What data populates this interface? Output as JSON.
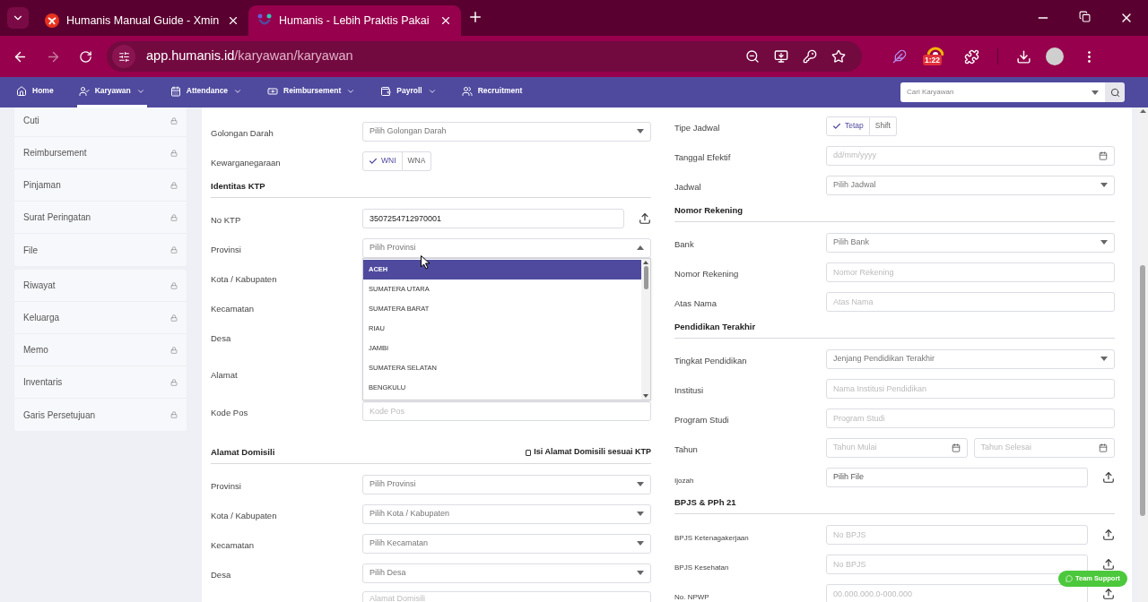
{
  "browser": {
    "tabs": [
      {
        "title": "Humanis Manual Guide - Xmin",
        "selected": false
      },
      {
        "title": "Humanis - Lebih Praktis Pakai",
        "selected": true
      }
    ],
    "url_host": "app.humanis.id",
    "url_path": "/karyawan/karyawan",
    "extension_badge": "1:22"
  },
  "nav": {
    "items": [
      {
        "label": "Home",
        "selected": false,
        "has_menu": false
      },
      {
        "label": "Karyawan",
        "selected": true,
        "has_menu": true
      },
      {
        "label": "Attendance",
        "selected": false,
        "has_menu": true
      },
      {
        "label": "Reimbursement",
        "selected": false,
        "has_menu": true
      },
      {
        "label": "Payroll",
        "selected": false,
        "has_menu": true
      },
      {
        "label": "Recruitment",
        "selected": false,
        "has_menu": false
      }
    ],
    "search_placeholder": "Cari Karyawan"
  },
  "sidebar": {
    "groups": [
      {
        "items": [
          {
            "label": "Cuti",
            "locked": true
          },
          {
            "label": "Reimbursement",
            "locked": true
          },
          {
            "label": "Pinjaman",
            "locked": true
          },
          {
            "label": "Surat Peringatan",
            "locked": true
          },
          {
            "label": "File",
            "locked": true
          }
        ]
      },
      {
        "items": [
          {
            "label": "Riwayat",
            "locked": true
          },
          {
            "label": "Keluarga",
            "locked": true
          },
          {
            "label": "Memo",
            "locked": true
          },
          {
            "label": "Inventaris",
            "locked": true
          },
          {
            "label": "Garis Persetujuan",
            "locked": true
          }
        ]
      }
    ]
  },
  "form": {
    "left": [
      {
        "kind": "select",
        "label": "Golongan Darah",
        "placeholder": "Pilih Golongan Darah",
        "expanded": false
      },
      {
        "kind": "toggle",
        "label": "Kewarganegaraan",
        "options": [
          {
            "label": "WNI",
            "selected": true
          },
          {
            "label": "WNA",
            "selected": false
          }
        ]
      },
      {
        "kind": "heading",
        "label": "Identitas KTP"
      },
      {
        "kind": "input",
        "label": "No KTP",
        "value": "3507254712970001",
        "upload": true
      },
      {
        "kind": "select",
        "label": "Provinsi",
        "placeholder": "Pilih Provinsi",
        "expanded": true,
        "options": [
          {
            "label": "ACEH",
            "selected": true
          },
          {
            "label": "SUMATERA UTARA",
            "selected": false
          },
          {
            "label": "SUMATERA BARAT",
            "selected": false
          },
          {
            "label": "RIAU",
            "selected": false
          },
          {
            "label": "JAMBI",
            "selected": false
          },
          {
            "label": "SUMATERA SELATAN",
            "selected": false
          },
          {
            "label": "BENGKULU",
            "selected": false
          }
        ]
      },
      {
        "kind": "label",
        "label": "Kota / Kabupaten"
      },
      {
        "kind": "label",
        "label": "Kecamatan"
      },
      {
        "kind": "label",
        "label": "Desa"
      },
      {
        "kind": "tall_label",
        "label": "Alamat"
      },
      {
        "kind": "input",
        "label": "Kode Pos",
        "placeholder": "Kode Pos"
      },
      {
        "kind": "heading",
        "label": "Alamat Domisili",
        "checkbox": {
          "label": "Isi Alamat Domisili sesuai KTP",
          "checked": false
        }
      },
      {
        "kind": "select",
        "label": "Provinsi",
        "placeholder": "Pilih Provinsi",
        "expanded": false
      },
      {
        "kind": "select",
        "label": "Kota / Kabupaten",
        "placeholder": "Pilih Kota / Kabupaten",
        "expanded": false
      },
      {
        "kind": "select",
        "label": "Kecamatan",
        "placeholder": "Pilih Kecamatan",
        "expanded": false
      },
      {
        "kind": "select",
        "label": "Desa",
        "placeholder": "Pilih Desa",
        "expanded": false
      },
      {
        "kind": "textarea",
        "placeholder": "Alamat Domisili"
      }
    ],
    "right": [
      {
        "kind": "toggle",
        "label": "Tipe Jadwal",
        "options": [
          {
            "label": "Tetap",
            "selected": true
          },
          {
            "label": "Shift",
            "selected": false
          }
        ]
      },
      {
        "kind": "date",
        "label": "Tanggal Efektif",
        "placeholder": "dd/mm/yyyy"
      },
      {
        "kind": "select",
        "label": "Jadwal",
        "placeholder": "Pilih Jadwal",
        "expanded": false
      },
      {
        "kind": "heading",
        "label": "Nomor Rekening"
      },
      {
        "kind": "select",
        "label": "Bank",
        "placeholder": "Pilih Bank",
        "expanded": false
      },
      {
        "kind": "input",
        "label": "Nomor Rekening",
        "placeholder": "Nomor Rekening"
      },
      {
        "kind": "input",
        "label": "Atas Nama",
        "placeholder": "Atas Nama"
      },
      {
        "kind": "heading",
        "label": "Pendidikan Terakhir"
      },
      {
        "kind": "select",
        "label": "Tingkat Pendidikan",
        "placeholder": "Jenjang Pendidikan Terakhir",
        "expanded": false
      },
      {
        "kind": "input",
        "label": "Institusi",
        "placeholder": "Nama Institusi Pendidikan"
      },
      {
        "kind": "input",
        "label": "Program Studi",
        "placeholder": "Program Studi"
      },
      {
        "kind": "date_pair",
        "label": "Tahun",
        "placeholders": [
          "Tahun Mulai",
          "Tahun Selesai"
        ]
      },
      {
        "kind": "file",
        "label": "Ijozah",
        "button": "Pilih File",
        "upload": true,
        "small_label": true
      },
      {
        "kind": "heading",
        "label": "BPJS & PPh 21"
      },
      {
        "kind": "input",
        "label": "BPJS Ketenagakerjaan",
        "placeholder": "No BPJS",
        "upload": true,
        "small_label": true
      },
      {
        "kind": "input",
        "label": "BPJS Kesehatan",
        "placeholder": "No BPJS",
        "upload": true,
        "small_label": true
      },
      {
        "kind": "input",
        "label": "No. NPWP",
        "placeholder": "00.000.000.0-000.000",
        "upload": true,
        "small_label": true
      }
    ]
  },
  "support_button": "Team Support"
}
